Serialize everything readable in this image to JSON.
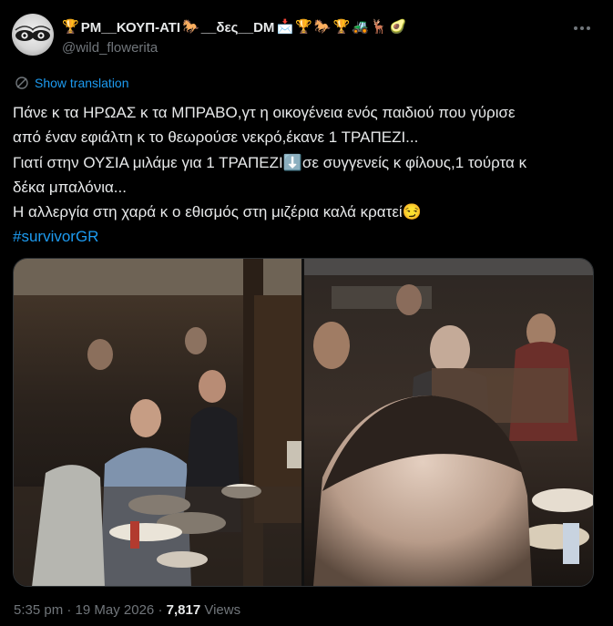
{
  "author": {
    "emoji_prefix": "🏆",
    "display_name": "PM__ΚΟΥΠ-ΑΤΙ",
    "name_emojis": [
      "🐎",
      "__δες__DM",
      "📩",
      "🏆",
      "🐎",
      "🏆",
      "🚜",
      "🦌",
      "🥑"
    ],
    "handle": "@wild_flowerita"
  },
  "menu_icon": "more-dots-icon",
  "translation": {
    "icon": "translate-icon",
    "label": "Show translation"
  },
  "body": {
    "line1": "Πάνε κ τα ΗΡΩΑΣ κ τα ΜΠΡΑΒΟ,γτ η οικογένεια ενός παιδιού που γύρισε",
    "line2": "από έναν εφιάλτη κ το θεωρούσε νεκρό,έκανε 1 ΤΡΑΠΕΖΙ...",
    "line3a": "Γιατί στην ΟΥΣΙΑ μιλάμε για 1 ΤΡΑΠΕΖΙ",
    "line3_emoji": "⬇️",
    "line3b": "σε συγγενείς κ φίλους,1 τούρτα κ",
    "line4": "δέκα μπαλόνια...",
    "line5": "Η αλλεργία στη χαρά κ ο εθισμός στη μιζέρια καλά κρατεί",
    "line5_emoji": "😏",
    "hashtag": "#survivorGR"
  },
  "media": {
    "left_photo": "restaurant group photo",
    "right_photo": "restaurant selfie photo"
  },
  "meta": {
    "time": "5:35 pm",
    "separator": " · ",
    "date": "19 May 2026",
    "separator2": " · ",
    "views_count": "7,817",
    "views_label": " Views"
  },
  "colors": {
    "background": "#000000",
    "text": "#e7e9ea",
    "muted": "#71767b",
    "link": "#1d9bf0",
    "border": "#2f3336"
  }
}
